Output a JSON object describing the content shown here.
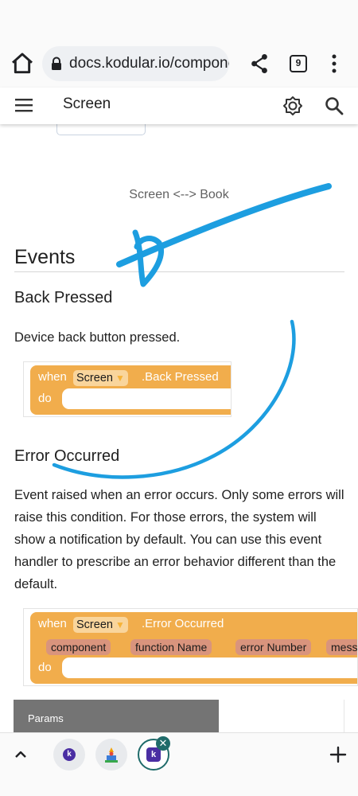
{
  "browser": {
    "url": "docs.kodular.io/components/",
    "tab_count": "9"
  },
  "appbar": {
    "title": "Screen"
  },
  "content": {
    "caption": "Screen <--> Book",
    "section_title": "Events",
    "events": [
      {
        "title": "Back Pressed",
        "description": "Device back button pressed.",
        "block": {
          "when": "when",
          "component": "Screen",
          "dropdown": "▼",
          "event": ".Back Pressed",
          "do": "do"
        }
      },
      {
        "title": "Error Occurred",
        "description": "Event raised when an error occurs. Only some errors will raise this condition. For those errors, the system will show a notification by default. You can use this event handler to prescribe an error behavior different than the default.",
        "block": {
          "when": "when",
          "component": "Screen",
          "dropdown": "▼",
          "event": ".Error Occurred",
          "params": [
            "component",
            "function Name",
            "error Number",
            "message"
          ],
          "do": "do"
        }
      }
    ],
    "params_header": "Params"
  },
  "bottom": {
    "tab1_logo": "k",
    "tab3_logo": "k",
    "close_glyph": "✕"
  },
  "colors": {
    "block": "#f1ad4c",
    "pill": "#f9d59c",
    "param": "#d9947d",
    "scribble": "#1d9ee0",
    "active_tab": "#1f6b6a"
  }
}
